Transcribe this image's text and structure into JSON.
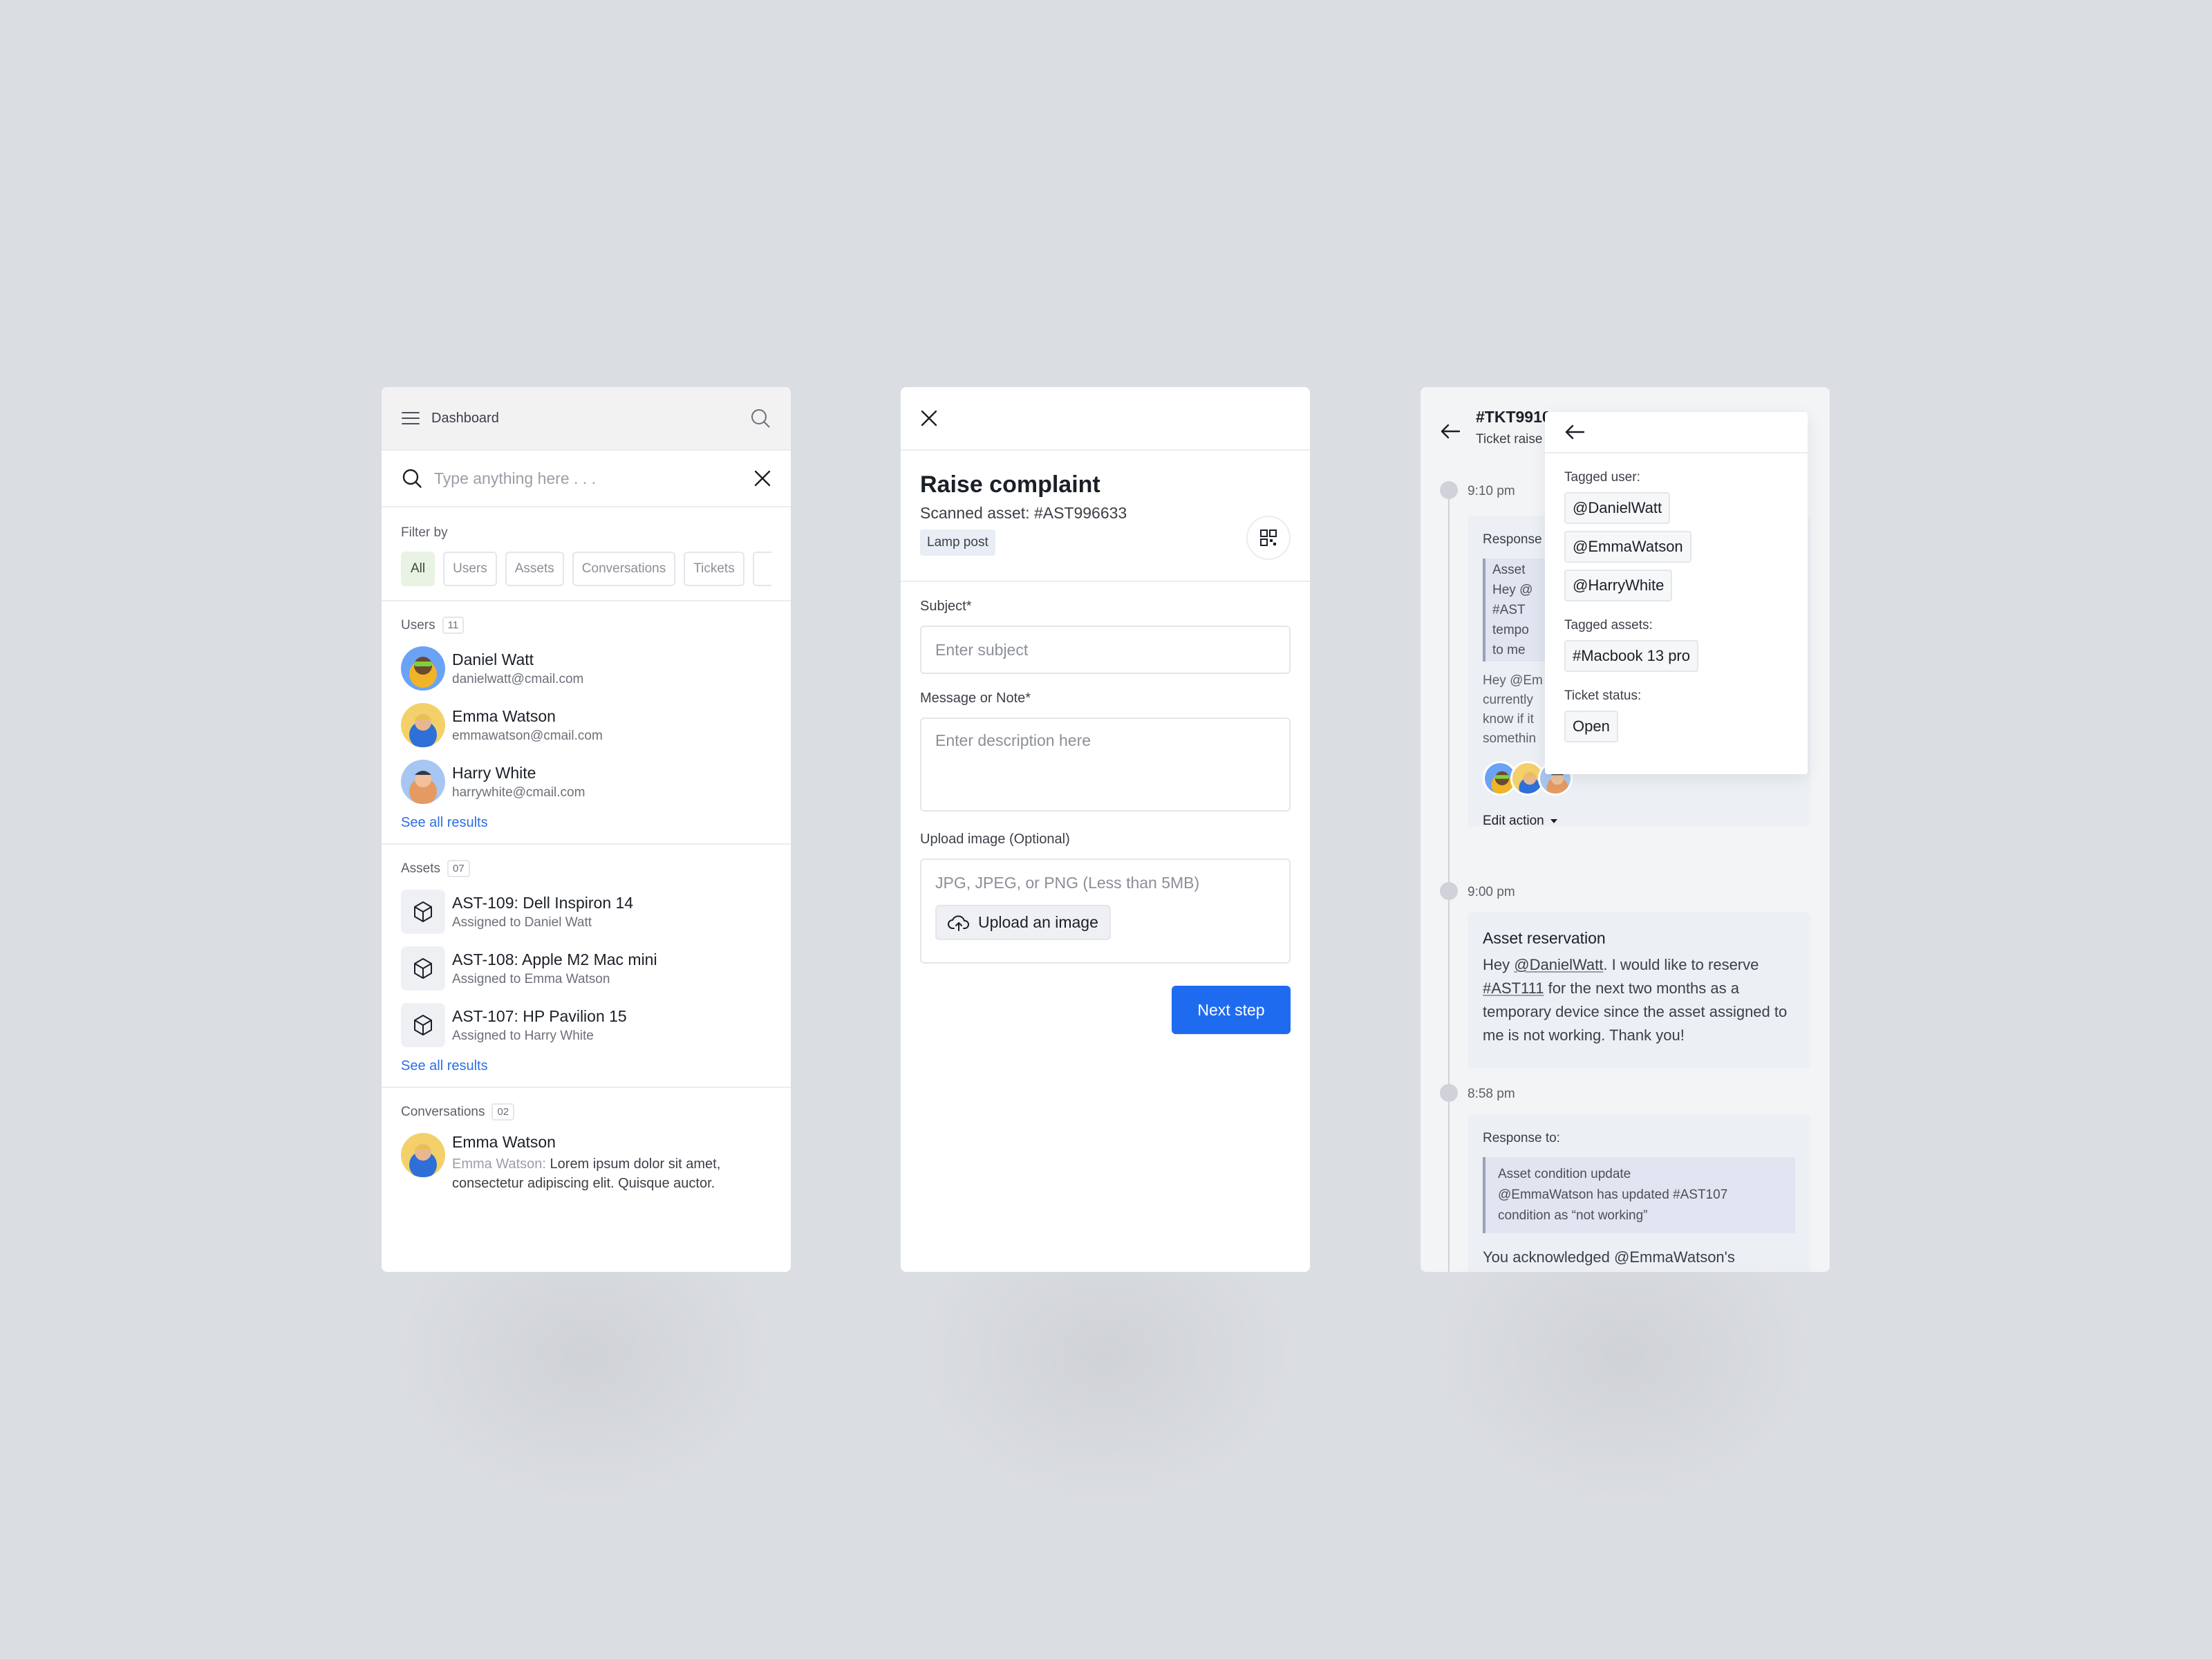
{
  "search_panel": {
    "header_title": "Dashboard",
    "search_placeholder": "Type anything here . . .",
    "filter_label": "Filter by",
    "filters": [
      "All",
      "Users",
      "Assets",
      "Conversations",
      "Tickets"
    ],
    "users": {
      "label": "Users",
      "count": "11",
      "items": [
        {
          "name": "Daniel Watt",
          "email": "danielwatt@cmail.com"
        },
        {
          "name": "Emma Watson",
          "email": "emmawatson@cmail.com"
        },
        {
          "name": "Harry White",
          "email": "harrywhite@cmail.com"
        }
      ],
      "see_all": "See all results"
    },
    "assets": {
      "label": "Assets",
      "count": "07",
      "items": [
        {
          "name": "AST-109: Dell Inspiron 14",
          "assigned": "Assigned to Daniel Watt"
        },
        {
          "name": "AST-108: Apple M2 Mac mini",
          "assigned": "Assigned to Emma Watson"
        },
        {
          "name": "AST-107: HP Pavilion 15",
          "assigned": "Assigned to Harry White"
        }
      ],
      "see_all": "See all results"
    },
    "conversations": {
      "label": "Conversations",
      "count": "02",
      "items": [
        {
          "name": "Emma Watson",
          "sender": "Emma Watson:",
          "message": "Lorem ipsum dolor sit amet, consectetur adipiscing elit. Quisque auctor."
        }
      ]
    }
  },
  "complaint_panel": {
    "title": "Raise complaint",
    "scanned_asset": "Scanned asset: #AST996633",
    "asset_tag": "Lamp post",
    "subject_label": "Subject*",
    "subject_placeholder": "Enter subject",
    "message_label": "Message or Note*",
    "message_placeholder": "Enter description here",
    "upload_label": "Upload image (Optional)",
    "upload_hint": "JPG, JPEG, or PNG (Less than 5MB)",
    "upload_button": "Upload an image",
    "next_button": "Next step"
  },
  "ticket_panel": {
    "ticket_id": "#TKT9910",
    "ticket_sub": "Ticket raise",
    "events": [
      {
        "time": "9:10 pm",
        "response_label": "Response",
        "quote_lines": [
          "Asset",
          "Hey @",
          "#AST",
          "tempo",
          "to me"
        ],
        "body_lines": [
          "Hey @Em",
          "currently",
          "know if it",
          "somethin"
        ],
        "edit_action": "Edit action"
      },
      {
        "time": "9:00 pm",
        "title": "Asset reservation",
        "text_parts": [
          "Hey ",
          "@DanielWatt",
          ". I would like to reserve ",
          "#AST111",
          " for the next two months as a temporary device since the asset assigned to me is not working. Thank you!"
        ]
      },
      {
        "time": "8:58 pm",
        "response_label": "Response to:",
        "quote_title": "Asset condition update",
        "quote_text": "@EmmaWatson has updated #AST107 condition as “not working”",
        "body": "You acknowledged @EmmaWatson's"
      }
    ],
    "popover": {
      "tagged_users_label": "Tagged user:",
      "tagged_users": [
        "@DanielWatt",
        "@EmmaWatson",
        "@HarryWhite"
      ],
      "tagged_assets_label": "Tagged assets:",
      "tagged_assets": [
        "#Macbook 13 pro"
      ],
      "status_label": "Ticket status:",
      "status": "Open"
    }
  },
  "colors": {
    "background": "#dadde2",
    "accent_blue": "#1f6bf0",
    "link_blue": "#2c6ee8",
    "active_filter": "#e8f3e3"
  }
}
